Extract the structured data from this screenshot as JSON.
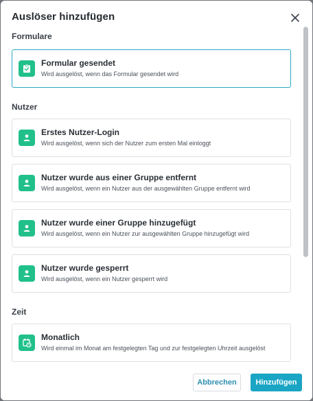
{
  "dialog": {
    "title": "Auslöser hinzufügen",
    "close_icon": "close-icon"
  },
  "sections": [
    {
      "title": "Formulare",
      "items": [
        {
          "title": "Formular gesendet",
          "desc": "Wird ausgelöst, wenn das Formular gesendet wird",
          "icon": "form-check-icon",
          "selected": true
        }
      ]
    },
    {
      "title": "Nutzer",
      "items": [
        {
          "title": "Erstes Nutzer-Login",
          "desc": "Wird ausgelöst, wenn sich der Nutzer zum ersten Mal einloggt",
          "icon": "user-icon"
        },
        {
          "title": "Nutzer wurde aus einer Gruppe entfernt",
          "desc": "Wird ausgelöst, wenn ein Nutzer aus der ausgewählten Gruppe entfernt wird",
          "icon": "user-icon"
        },
        {
          "title": "Nutzer wurde einer Gruppe hinzugefügt",
          "desc": "Wird ausgelöst, wenn ein Nutzer zur ausgewählten Gruppe hinzugefügt wird",
          "icon": "user-icon"
        },
        {
          "title": "Nutzer wurde gesperrt",
          "desc": "Wird ausgelöst, wenn ein Nutzer gesperrt wird",
          "icon": "user-icon"
        }
      ]
    },
    {
      "title": "Zeit",
      "items": [
        {
          "title": "Monatlich",
          "desc": "Wird einmal im Monat am festgelegten Tag und zur festgelegten Uhrzeit ausgelöst",
          "icon": "calendar-clock-icon"
        }
      ]
    }
  ],
  "footer": {
    "cancel_label": "Abbrechen",
    "add_label": "Hinzufügen"
  },
  "colors": {
    "accent": "#1aa5c4",
    "icon_bg": "#21c08b",
    "selected_border": "#2aa7c4"
  }
}
